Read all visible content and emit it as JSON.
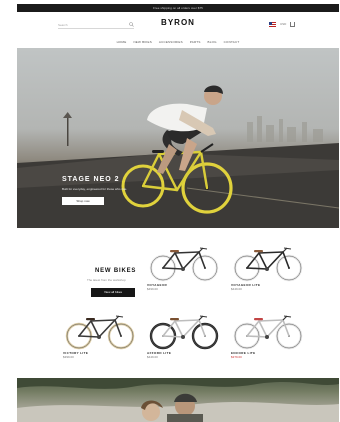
{
  "announcement": "Free shipping on all orders over $75",
  "header": {
    "search_placeholder": "Search",
    "logo": "BYRON",
    "currency": "USD",
    "nav": [
      "HOME",
      "NEW BIKES",
      "ACCESSORIES",
      "PARTS",
      "BLOG",
      "CONTACT"
    ]
  },
  "hero": {
    "title": "STAGE NEO 2",
    "subtitle": "Built for everyday, engineered for those who ride.",
    "button": "Shop now"
  },
  "new_bikes": {
    "title": "NEW BIKES",
    "subtitle": "The latest from the workshop",
    "button": "View all bikes",
    "products": [
      {
        "name": "VOYAGEUR",
        "price": "$499.00",
        "frame": "#333333",
        "tire": "#e8e8e8",
        "saddle": "#8a5a3a"
      },
      {
        "name": "VOYAGEUR LITE",
        "price": "$449.00",
        "frame": "#2a2a2a",
        "tire": "#e6e6e6",
        "saddle": "#8a5a3a"
      },
      {
        "name": "VICTORY LITE",
        "price": "$399.00",
        "frame": "#3a3a3a",
        "tire": "#d9c9a2",
        "saddle": "#3a2a20"
      },
      {
        "name": "AFFORD LITE",
        "price": "$449.00",
        "frame": "#f2f2f2",
        "tire": "#2b2b2b",
        "saddle": "#7a5030"
      },
      {
        "name": "ENCORE LITE",
        "price": "$379.00",
        "frame": "#f0f0f0",
        "tire": "#e2e2e2",
        "saddle": "#c24545",
        "sale": true
      }
    ]
  }
}
